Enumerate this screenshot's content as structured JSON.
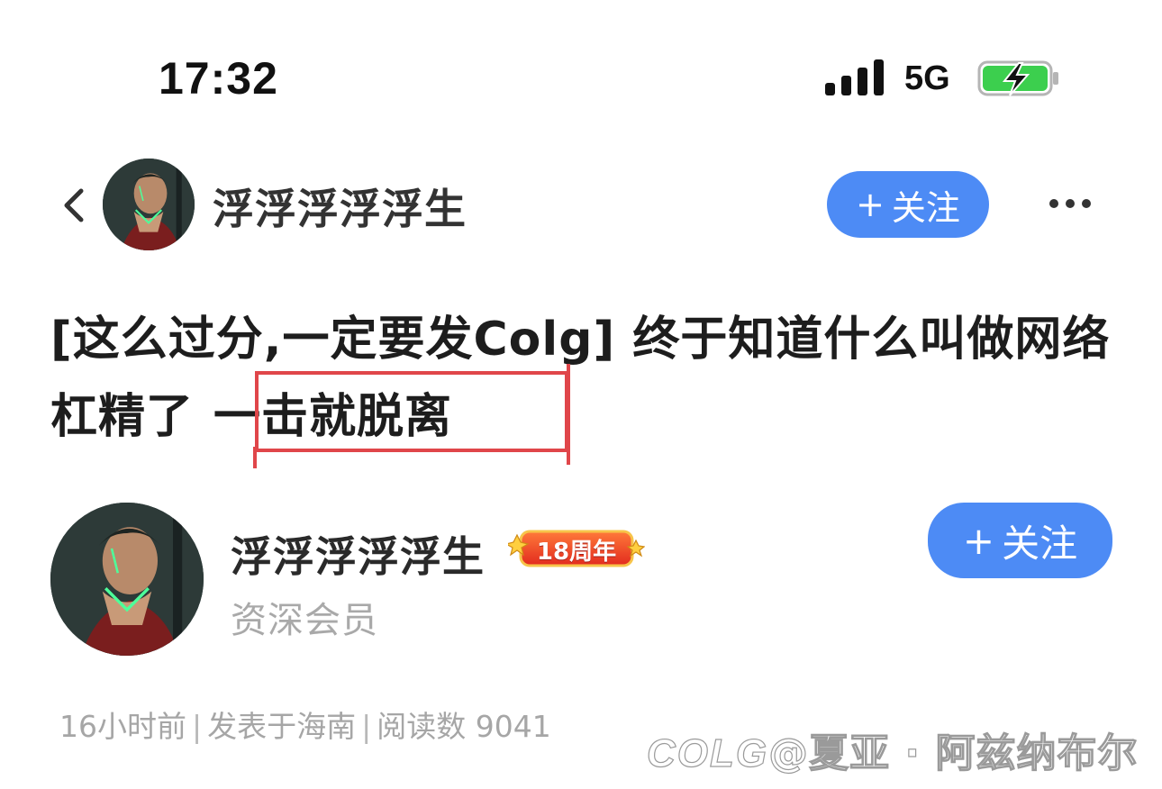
{
  "status_bar": {
    "time": "17:32",
    "network": "5G",
    "battery": "charging"
  },
  "header": {
    "username": "浮浮浮浮浮生",
    "follow_plus": "+",
    "follow_label": "关注",
    "back_icon": "chevron-left-icon",
    "more_icon": "more-dots-icon"
  },
  "post": {
    "title_part1": "[这么过分,一定要发Colg] 终于知道什么叫做网络杠精了",
    "title_highlight": "一击就脱离",
    "highlight_color": "#e0464a"
  },
  "author": {
    "name": "浮浮浮浮浮生",
    "badge": "18周年",
    "level": "资深会员",
    "follow_plus": "+",
    "follow_label": "关注"
  },
  "meta": {
    "time_ago": "16小时前",
    "location": "发表于海南",
    "reads": "阅读数 9041",
    "separator": "|"
  },
  "watermark": {
    "brand": "COLG",
    "text": "@夏亚 · 阿兹纳布尔"
  },
  "colors": {
    "follow_button": "#4d8bf5",
    "meta_text": "#a6a6a6",
    "battery_fill": "#3ccf4e"
  }
}
